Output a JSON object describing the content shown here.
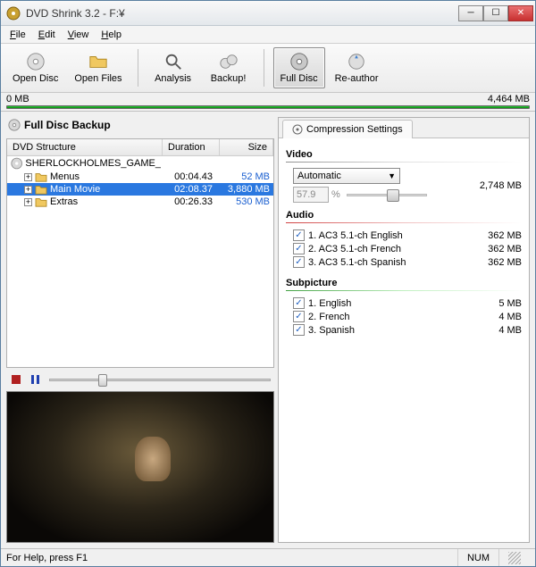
{
  "window": {
    "title": "DVD Shrink 3.2 - F:¥"
  },
  "menu": {
    "file": "File",
    "edit": "Edit",
    "view": "View",
    "help": "Help"
  },
  "toolbar": {
    "open_disc": "Open Disc",
    "open_files": "Open Files",
    "analysis": "Analysis",
    "backup": "Backup!",
    "full_disc": "Full Disc",
    "reauthor": "Re-author"
  },
  "progress": {
    "left": "0 MB",
    "right": "4,464 MB"
  },
  "left": {
    "heading": "Full Disc Backup",
    "columns": {
      "structure": "DVD Structure",
      "duration": "Duration",
      "size": "Size"
    },
    "root": "SHERLOCKHOLMES_GAME_",
    "rows": [
      {
        "name": "Menus",
        "duration": "00:04.43",
        "size": "52 MB",
        "selected": false,
        "expand": "+"
      },
      {
        "name": "Main Movie",
        "duration": "02:08.37",
        "size": "3,880 MB",
        "selected": true,
        "expand": "+"
      },
      {
        "name": "Extras",
        "duration": "00:26.33",
        "size": "530 MB",
        "selected": false,
        "expand": "+"
      }
    ]
  },
  "right": {
    "tab": "Compression Settings",
    "video": {
      "title": "Video",
      "mode": "Automatic",
      "ratio": "57.9",
      "pct": "%",
      "size": "2,748 MB"
    },
    "audio": {
      "title": "Audio",
      "items": [
        {
          "label": "1. AC3 5.1-ch English",
          "size": "362 MB"
        },
        {
          "label": "2. AC3 5.1-ch French",
          "size": "362 MB"
        },
        {
          "label": "3. AC3 5.1-ch Spanish",
          "size": "362 MB"
        }
      ]
    },
    "subpicture": {
      "title": "Subpicture",
      "items": [
        {
          "label": "1. English",
          "size": "5 MB"
        },
        {
          "label": "2. French",
          "size": "4 MB"
        },
        {
          "label": "3. Spanish",
          "size": "4 MB"
        }
      ]
    }
  },
  "status": {
    "help": "For Help, press F1",
    "num": "NUM"
  }
}
